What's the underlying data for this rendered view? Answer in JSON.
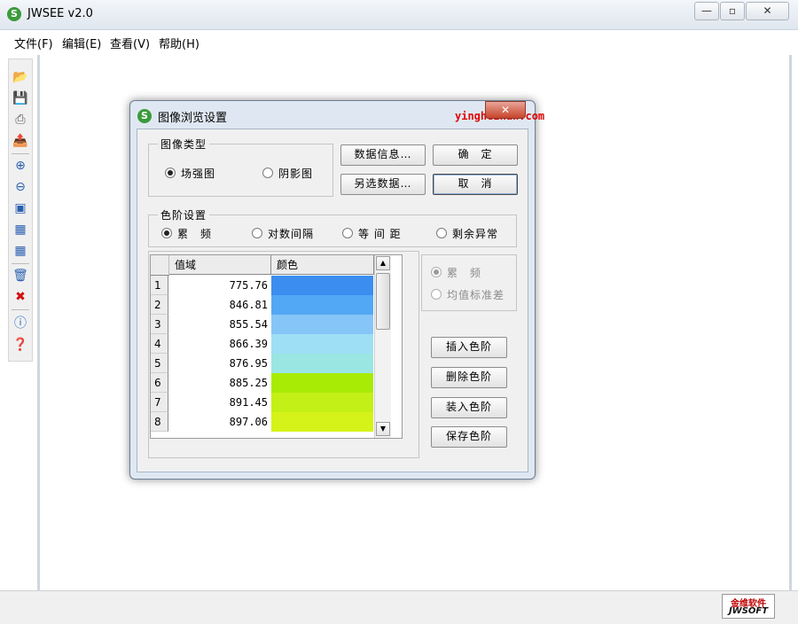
{
  "window": {
    "title": "JWSEE v2.0",
    "controls": {
      "minimize": "—",
      "maximize": "▫",
      "close": "✕"
    }
  },
  "menu": [
    "文件(F)",
    "编辑(E)",
    "查看(V)",
    "帮助(H)"
  ],
  "toolbar_icons": [
    "open-folder-icon",
    "save-icon",
    "print-icon",
    "export-icon",
    "zoom-in-icon",
    "zoom-out-icon",
    "fit-image-icon",
    "actual-size-icon",
    "grid-icon",
    "trash-icon",
    "delete-x-icon",
    "info-icon",
    "help-icon"
  ],
  "brand": {
    "cn": "金维软件",
    "en": "JWSOFT"
  },
  "watermark": "yinghezhan.com",
  "dialog": {
    "title": "图像浏览设置",
    "close": "✕",
    "image_type": {
      "title": "图像类型",
      "options": [
        {
          "label": "场强图",
          "checked": true
        },
        {
          "label": "阴影图",
          "checked": false
        }
      ]
    },
    "buttons": {
      "data_info": "数据信息…",
      "select_other_data": "另选数据…",
      "ok": "确　定",
      "cancel": "取　消"
    },
    "color_scale": {
      "title": "色阶设置",
      "options": [
        {
          "label": "累　频",
          "checked": true
        },
        {
          "label": "对数间隔",
          "checked": false
        },
        {
          "label": "等 间 距",
          "checked": false
        },
        {
          "label": "剩余异常",
          "checked": false
        }
      ]
    },
    "table": {
      "headers": [
        "值域",
        "颜色"
      ],
      "rows": [
        {
          "index": "1",
          "value": "775.76",
          "color": "#3b8ef0"
        },
        {
          "index": "2",
          "value": "846.81",
          "color": "#52a8f4"
        },
        {
          "index": "3",
          "value": "855.54",
          "color": "#86c5f7"
        },
        {
          "index": "4",
          "value": "866.39",
          "color": "#9fdff5"
        },
        {
          "index": "5",
          "value": "876.95",
          "color": "#9ae6e2"
        },
        {
          "index": "6",
          "value": "885.25",
          "color": "#a8ec05"
        },
        {
          "index": "7",
          "value": "891.45",
          "color": "#c3f016"
        },
        {
          "index": "8",
          "value": "897.06",
          "color": "#d5f318"
        }
      ],
      "scroll_up": "▲",
      "scroll_down": "▼"
    },
    "mode_options": [
      {
        "label": "累　频",
        "checked": true
      },
      {
        "label": "均值标准差",
        "checked": false
      }
    ],
    "side_buttons": [
      "插入色阶",
      "删除色阶",
      "装入色阶",
      "保存色阶"
    ]
  }
}
